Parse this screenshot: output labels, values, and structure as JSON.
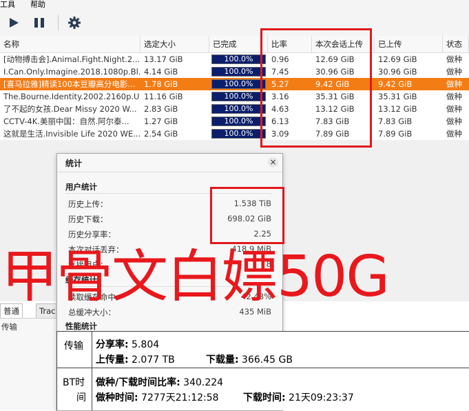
{
  "menu": {
    "tools": "工具",
    "help": "帮助"
  },
  "toolbar": {
    "play_icon": "play-icon",
    "pause_icon": "pause-icon",
    "settings_icon": "gear-icon"
  },
  "columns": [
    "名称",
    "选定大小",
    "已完成",
    "比率",
    "本次会话上传",
    "已上传",
    "状态"
  ],
  "rows": [
    {
      "name": "[动物搏击会].Animal.Fight.Night.2...",
      "size": "13.17 GiB",
      "progress": "100.0%",
      "progress_value": 1.0,
      "ratio": "0.96",
      "session_up": "12.69 GiB",
      "uploaded": "12.69 GiB",
      "status": "做种",
      "selected": false
    },
    {
      "name": "I.Can.Only.Imagine.2018.1080p.Bl...",
      "size": "4.14 GiB",
      "progress": "100.0%",
      "progress_value": 1.0,
      "ratio": "7.45",
      "session_up": "30.96 GiB",
      "uploaded": "30.96 GiB",
      "status": "做种",
      "selected": false
    },
    {
      "name": "[喜马拉雅]精读100本豆瓣高分电影...",
      "size": "1.78 GiB",
      "progress": "100.0%",
      "progress_value": 1.0,
      "ratio": "5.27",
      "session_up": "9.42 GiB",
      "uploaded": "9.42 GiB",
      "status": "做种",
      "selected": true
    },
    {
      "name": "The.Bourne.Identity.2002.2160p.U...",
      "size": "11.16 GiB",
      "progress": "100.0%",
      "progress_value": 1.0,
      "ratio": "3.16",
      "session_up": "35.31 GiB",
      "uploaded": "35.31 GiB",
      "status": "做种",
      "selected": false
    },
    {
      "name": "了不起的女孩.Dear Missy 2020 W...",
      "size": "2.83 GiB",
      "progress": "100.0%",
      "progress_value": 1.0,
      "ratio": "4.63",
      "session_up": "13.12 GiB",
      "uploaded": "13.12 GiB",
      "status": "做种",
      "selected": false
    },
    {
      "name": "CCTV-4K.美丽中国：自然.阿尔泰...",
      "size": "1.27 GiB",
      "progress": "100.0%",
      "progress_value": 1.0,
      "ratio": "6.13",
      "session_up": "7.83 GiB",
      "uploaded": "7.83 GiB",
      "status": "做种",
      "selected": false
    },
    {
      "name": "这就是生活.Invisible Life 2020 WE...",
      "size": "2.54 GiB",
      "progress": "100.0%",
      "progress_value": 1.0,
      "ratio": "3.09",
      "session_up": "7.89 GiB",
      "uploaded": "7.89 GiB",
      "status": "做种",
      "selected": false
    }
  ],
  "stats_dialog": {
    "title": "统计",
    "close": "×",
    "user_stats": "用户统计",
    "items": [
      {
        "label": "历史上传：",
        "value": "1.538 TiB"
      },
      {
        "label": "历史下载：",
        "value": "698.02 GiB"
      },
      {
        "label": "历史分享率：",
        "value": "2.25"
      },
      {
        "label": "本次对话丢弃：",
        "value": "418.9 MiB"
      },
      {
        "label": "连接用户：",
        "value": "8"
      }
    ],
    "cache_stats": "缓存统计",
    "cache_items": [
      {
        "label": "读取缓存命中：",
        "value": "42.48%"
      },
      {
        "label": "总缓冲大小：",
        "value": "435 MiB"
      }
    ],
    "perf_stats": "性能统计"
  },
  "tabs": [
    "普通",
    "Trac"
  ],
  "below_label": "传输",
  "overlay_text": "甲骨文白嫖50G",
  "bottom_table": {
    "row1_label": "传输",
    "share_ratio_label": "分享率:",
    "share_ratio": " 5.804",
    "upload_label": "上传量:",
    "upload": " 2.077 TB",
    "download_label": "下载量:",
    "download": " 366.45 GB",
    "row2_label_a": "BT时",
    "row2_label_b": "间",
    "seed_dl_ratio_label": "做种/下载时间比率:",
    "seed_dl_ratio": " 340.224",
    "seed_time_label": "做种时间:",
    "seed_time": " 7277天21:12:58",
    "dl_time_label": "下载时间:",
    "dl_time": " 21天09:23:37"
  },
  "colors": {
    "progress": "#0b1e6b",
    "selected_row": "#f47c15",
    "highlight": "#e0181a"
  }
}
